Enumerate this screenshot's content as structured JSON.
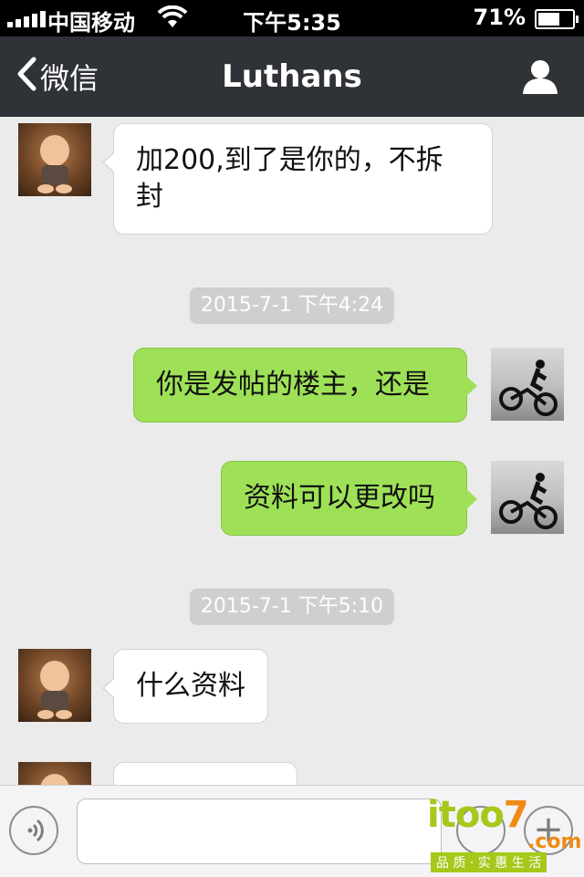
{
  "status_bar": {
    "carrier": "中国移动",
    "time": "下午5:35",
    "battery_percent": "71%",
    "battery_level": 0.71,
    "signal_bars": 5,
    "icons": [
      "signal-icon",
      "wifi-icon",
      "battery-icon"
    ]
  },
  "nav": {
    "back_label": "微信",
    "title": "Luthans",
    "icons": [
      "chevron-left-icon",
      "profile-icon"
    ]
  },
  "messages": [
    {
      "side": "left",
      "text_line1": "加200,到了是你的，不拆",
      "text_line2": "封"
    },
    {
      "timestamp": "2015-7-1 下午4:24"
    },
    {
      "side": "right",
      "text": "你是发帖的楼主，还是"
    },
    {
      "side": "right",
      "text": "资料可以更改吗"
    },
    {
      "timestamp": "2015-7-1 下午5:10"
    },
    {
      "side": "left",
      "text": "什么资料"
    },
    {
      "side": "left",
      "text": ""
    }
  ],
  "input_bar": {
    "placeholder": "",
    "icons": [
      "voice-icon",
      "emoji-icon",
      "plus-icon"
    ]
  },
  "watermark": {
    "main_text_a": "itoo",
    "main_text_b": "7",
    "suffix": ".com",
    "tagline": "品 质 · 实 惠 生 活"
  },
  "colors": {
    "nav_bg": "#2f3236",
    "chat_bg": "#ebebeb",
    "sent_bubble": "#9ee157",
    "received_bubble": "#ffffff",
    "timestamp_bg": "#cfcfcf"
  }
}
